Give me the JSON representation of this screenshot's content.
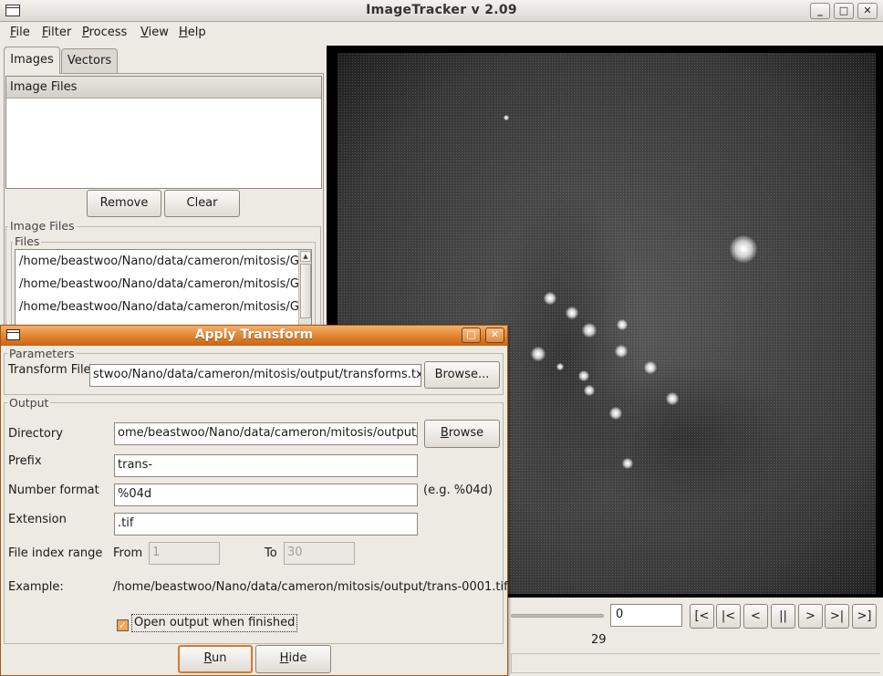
{
  "window": {
    "title": "ImageTracker v 2.09",
    "minimize_glyph": "_",
    "maximize_glyph": "□",
    "close_glyph": "✕"
  },
  "menu": [
    {
      "label": "File",
      "mnemonic": "F",
      "rest": "ile"
    },
    {
      "label": "Filter",
      "mnemonic": "F",
      "rest": "ilter"
    },
    {
      "label": "Process",
      "mnemonic": "P",
      "rest": "rocess"
    },
    {
      "label": "View",
      "mnemonic": "V",
      "rest": "iew"
    },
    {
      "label": "Help",
      "mnemonic": "H",
      "rest": "elp"
    }
  ],
  "tabs": [
    {
      "label": "Images",
      "active": true
    },
    {
      "label": "Vectors",
      "active": false
    }
  ],
  "image_list": {
    "header": "Image Files",
    "remove_label": "Remove",
    "clear_label": "Clear"
  },
  "files_panel": {
    "group_label": "Image Files",
    "files_label": "Files",
    "rows": [
      "/home/beastwoo/Nano/data/cameron/mitosis/Gc",
      "/home/beastwoo/Nano/data/cameron/mitosis/Gc",
      "/home/beastwoo/Nano/data/cameron/mitosis/Gc"
    ]
  },
  "player": {
    "frame_value": "0",
    "frame_count": "29",
    "buttons": [
      "[<",
      "|<",
      "<",
      "||",
      ">",
      ">|",
      ">]"
    ]
  },
  "dialog": {
    "title": "Apply Transform",
    "parameters_label": "Parameters",
    "transform_file_label": "Transform File",
    "transform_file_value": "stwoo/Nano/data/cameron/mitosis/output/transforms.txt",
    "browse_dots_label": "Browse...",
    "output_label": "Output",
    "directory_label": "Directory",
    "directory_value": "ome/beastwoo/Nano/data/cameron/mitosis/output/",
    "browse_label": "Browse",
    "browse_mnemonic": "B",
    "browse_rest": "rowse",
    "prefix_label": "Prefix",
    "prefix_value": "trans-",
    "number_format_label": "Number format",
    "number_format_value": "%04d",
    "number_format_hint": "(e.g. %04d)",
    "extension_label": "Extension",
    "extension_value": ".tif",
    "file_index_label": "File index range",
    "from_label": "From",
    "from_value": "1",
    "to_label": "To",
    "to_value": "30",
    "example_label": "Example:",
    "example_value": "/home/beastwoo/Nano/data/cameron/mitosis/output/trans-0001.tif",
    "open_output_label": "Open output when finished",
    "open_output_checked": true,
    "run_label": "Run",
    "run_mnemonic": "R",
    "run_rest": "un",
    "hide_label": "Hide",
    "hide_mnemonic": "H",
    "hide_rest": "ide"
  },
  "colors": {
    "dialog_accent": "#e0822f",
    "window_bg": "#ede9e3"
  }
}
